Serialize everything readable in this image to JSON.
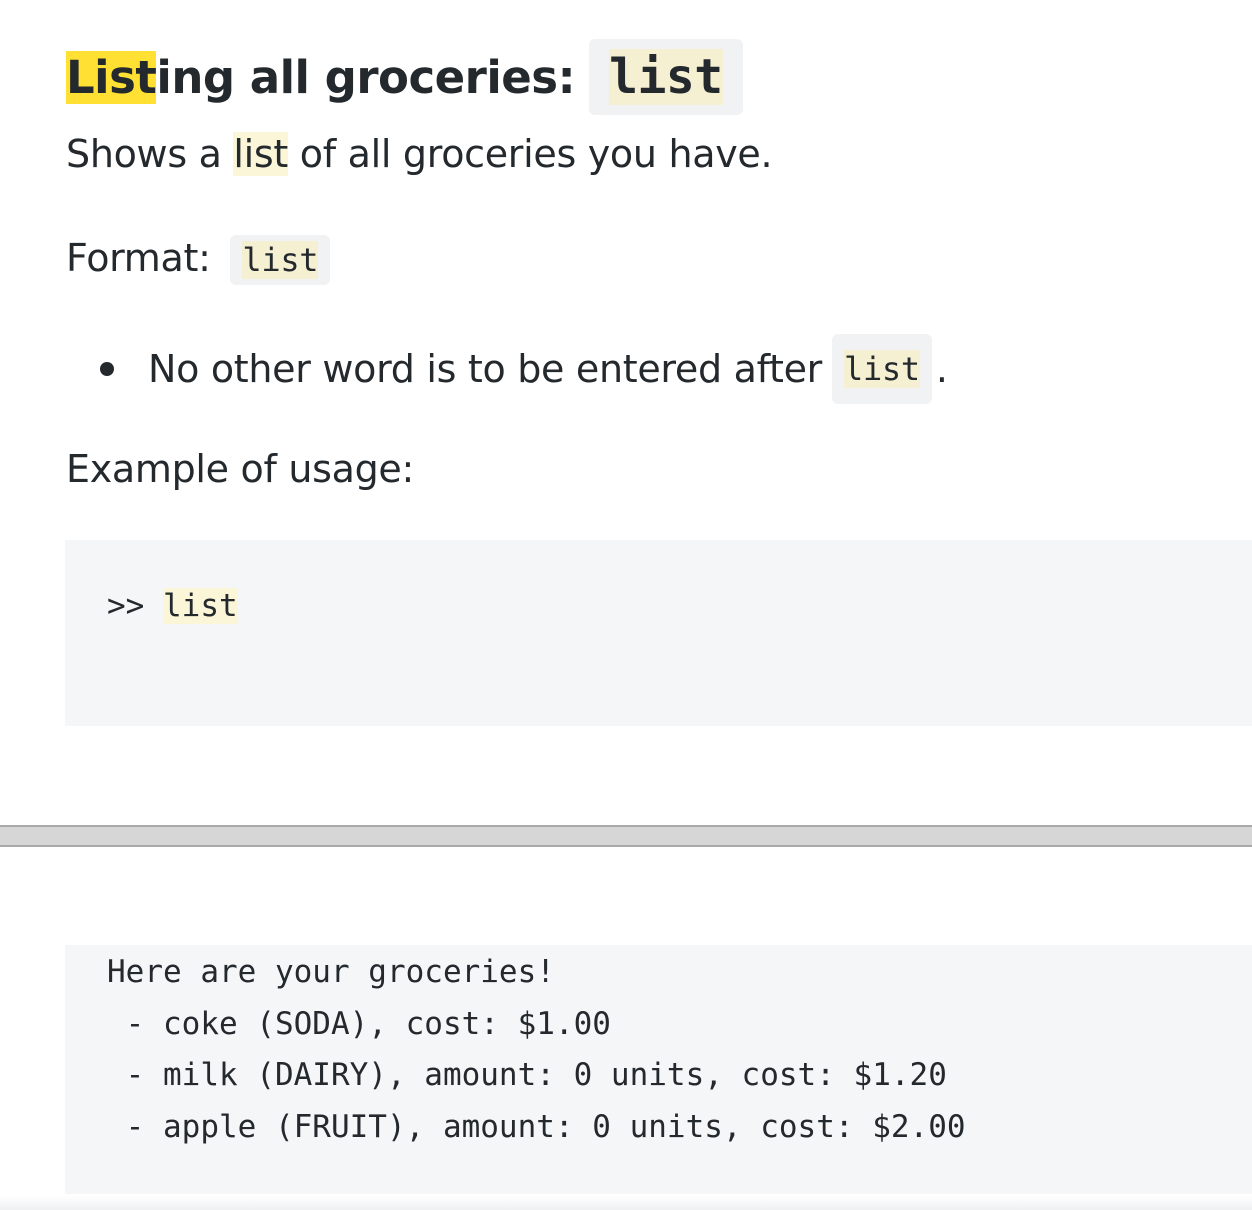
{
  "heading": {
    "highlighted_prefix": "List",
    "text_rest": "ing all groceries:",
    "command": "list"
  },
  "description": {
    "before": "Shows a ",
    "keyword": "list",
    "after": " of all groceries you have."
  },
  "format": {
    "label": "Format:",
    "command": "list"
  },
  "bullet": {
    "text": "No other word is to be entered after",
    "command": "list",
    "suffix": "."
  },
  "example_label": "Example of usage:",
  "usage_code": {
    "prompt": ">> ",
    "command": "list"
  },
  "output": {
    "lines": [
      "Here are your groceries!",
      " - coke (SODA), cost: $1.00",
      " - milk (DAIRY), amount: 0 units, cost: $1.20",
      " - apple (FRUIT), amount: 0 units, cost: $2.00"
    ]
  },
  "colors": {
    "search_highlight_strong": "#ffe033",
    "search_highlight": "#fbf6d8",
    "code_background": "#f5f6f8",
    "text": "#24292e"
  }
}
